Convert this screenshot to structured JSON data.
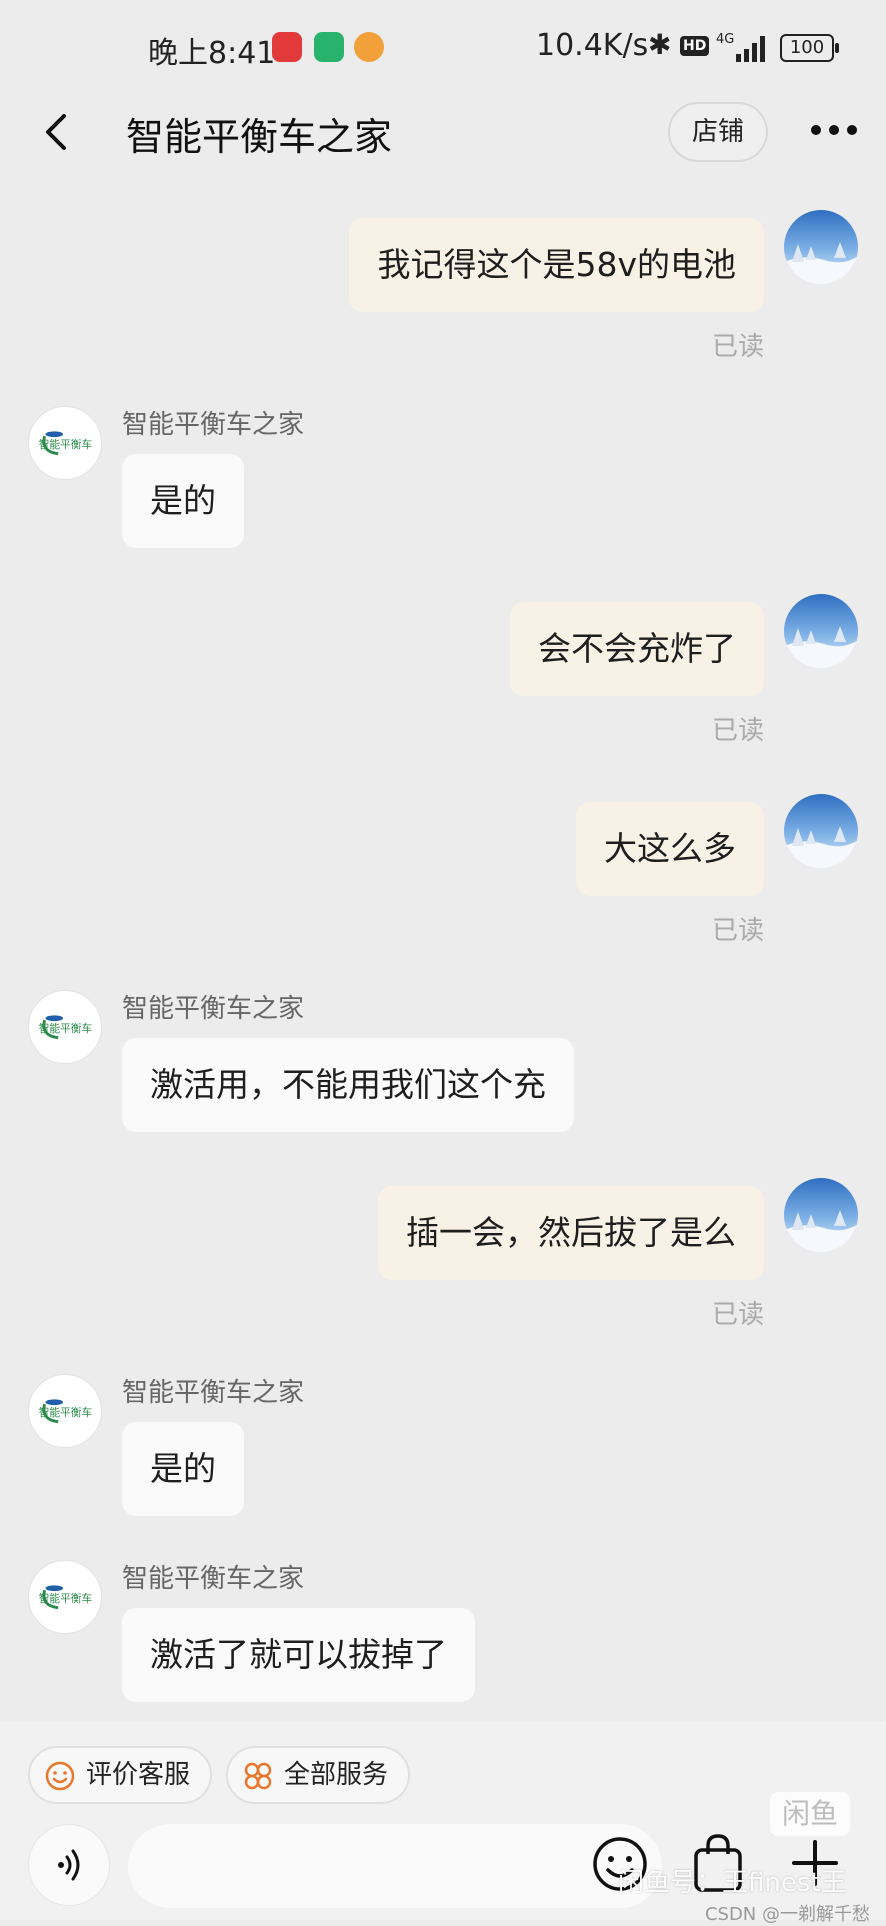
{
  "status_bar": {
    "time": "晚上8:41",
    "network_speed": "10.4K/s",
    "hd_badge": "HD",
    "signal": "4G",
    "battery": "100"
  },
  "nav": {
    "title": "智能平衡车之家",
    "shop_button": "店铺"
  },
  "messages": [
    {
      "from": "me",
      "text": "我记得这个是58v的电池",
      "read": "已读"
    },
    {
      "from": "shop",
      "sender": "智能平衡车之家",
      "text": "是的"
    },
    {
      "from": "me",
      "text": "会不会充炸了",
      "read": "已读"
    },
    {
      "from": "me",
      "text": "大这么多",
      "read": "已读"
    },
    {
      "from": "shop",
      "sender": "智能平衡车之家",
      "text": "激活用，不能用我们这个充"
    },
    {
      "from": "me",
      "text": "插一会，然后拔了是么",
      "read": "已读"
    },
    {
      "from": "shop",
      "sender": "智能平衡车之家",
      "text": "是的"
    },
    {
      "from": "shop",
      "sender": "智能平衡车之家",
      "text": "激活了就可以拔掉了"
    }
  ],
  "shop_avatar_text": "智能平衡车",
  "bottom": {
    "chip_rate": "评价客服",
    "chip_services": "全部服务",
    "input_placeholder": ""
  },
  "watermark": {
    "logo": "闲鱼",
    "text": "闲鱼号：王finest王",
    "csdn": "CSDN @一剃解千愁"
  },
  "colors": {
    "background": "#ececec",
    "my_bubble": "#f8f2e6",
    "shop_bubble": "#fafafa",
    "read_text": "#aaaaaa",
    "chip_icon": "#e8772e"
  },
  "icons": [
    "back-arrow-icon",
    "more-dots-icon",
    "smile-icon",
    "grid-flower-icon",
    "voice-icon",
    "emoji-icon",
    "shopping-bag-icon",
    "plus-icon",
    "bluetooth-icon"
  ]
}
